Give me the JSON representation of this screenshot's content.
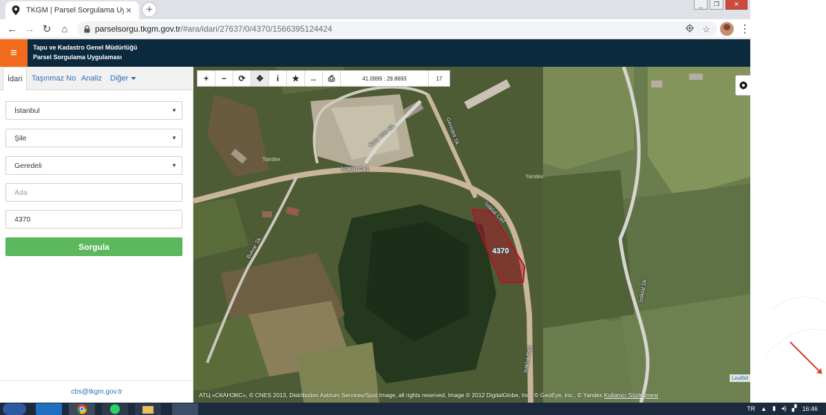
{
  "browser": {
    "tab_title": "TKGM | Parsel Sorgulama Uygula",
    "tab_close": "✕",
    "new_tab": "+",
    "url_host": "parselsorgu.tkgm.gov.tr",
    "url_path": "/#ara/idari/27637/0/4370/1566395124424",
    "back": "←",
    "forward": "→",
    "reload": "↻",
    "home": "⌂",
    "star": "☆",
    "menu": "⋮",
    "win_min": "_",
    "win_max": "❐",
    "win_close": "✕"
  },
  "header": {
    "org_title": "Tapu ve Kadastro Genel Müdürlüğü",
    "app_subtitle": "Parsel Sorgulama Uygulaması",
    "menu_icon": "≡"
  },
  "sidebar": {
    "tabs": [
      {
        "label": "İdari",
        "active": true
      },
      {
        "label": "Taşınmaz No",
        "active": false
      },
      {
        "label": "Analiz",
        "active": false
      },
      {
        "label": "Diğer",
        "active": false
      }
    ],
    "province": "İstanbul",
    "district": "Şile",
    "neighborhood": "Geredeli",
    "block_placeholder": "Ada",
    "parcel_value": "4370",
    "submit_label": "Sorgula",
    "footer_email": "cbs@tkgm.gov.tr"
  },
  "map": {
    "toolbar": {
      "zoom_in": "+",
      "zoom_out": "−",
      "refresh": "⟳",
      "locate": "✥",
      "info": "i",
      "favorite": "★",
      "measure": "↔",
      "print": "⎙"
    },
    "coordinates": "41.0999 : 29.8693",
    "zoom_level": "17",
    "parcel_label": "4370",
    "road_labels": {
      "istiklal_1": "İstiklal Cad.",
      "istiklal_2": "İstiklal Cad.",
      "istiklal_3": "İstiklal Cad.",
      "side_1": "Geredeli Sk.",
      "side_2": "Koru Yolu Sk.",
      "side_3": "Bulvar Sk.",
      "side_4": "İstiklal Sk."
    },
    "yandex_watermark": "Yandex",
    "attribution_text": "АТЦ «СКАНЭКС», © CNES 2013, Distribution Astrium Services/Spot Image, all rights reserved, Image © 2012 DigitalGlobe, Inc., © GeoEye, Inc., © Yandex",
    "attribution_terms": "Kullanıcı Sözleşmesi",
    "leaflet": "Leaflet",
    "parcel_color": "#b3122a"
  },
  "taskbar": {
    "language": "TR",
    "clock": "16:46"
  }
}
